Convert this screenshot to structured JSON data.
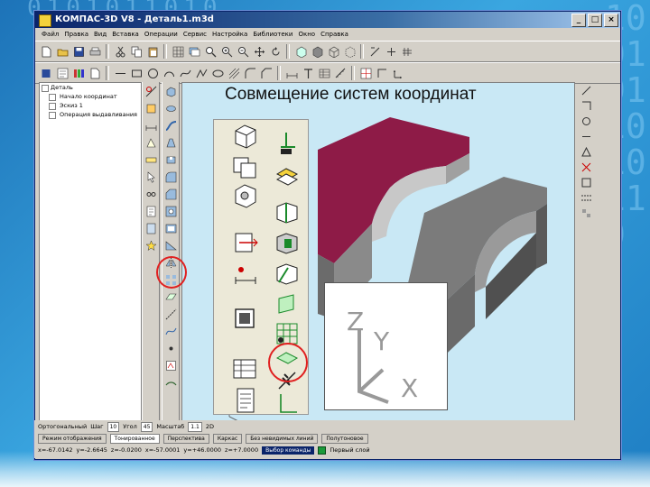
{
  "window": {
    "title": "КОМПАС-3D V8 - Деталь1.m3d"
  },
  "menu": [
    "Файл",
    "Правка",
    "Вид",
    "Вставка",
    "Операции",
    "Сервис",
    "Настройка",
    "Библиотеки",
    "Окно",
    "Справка"
  ],
  "tree": {
    "items": [
      {
        "label": "Деталь"
      },
      {
        "label": "Начало координат"
      },
      {
        "label": "Эскиз 1"
      },
      {
        "label": "Операция выдавливания"
      }
    ]
  },
  "slide": {
    "title": "Совмещение систем координат"
  },
  "axes": {
    "z": "Z",
    "y": "Y",
    "x": "X"
  },
  "status": {
    "row1": {
      "label1": "Ортогональный",
      "label2": "Шаг",
      "value1": "10",
      "label3": "Угол",
      "value2": "45",
      "label4": "Масштаб",
      "value3": "1.1",
      "value4": "2D"
    },
    "tabs": [
      "Режим отображения",
      "Тонированное",
      "Перспектива",
      "Каркас",
      "Без невидимых линий",
      "Полутоновое"
    ],
    "row3": {
      "x": "x=-67.0142",
      "y": "y=-2.6645",
      "z": "z=-0.0200",
      "coord1": "x=-57.0001",
      "coord2": "y=+46.0000",
      "coord3": "z=+7.0000",
      "command": "Выбор команды",
      "layer": "Первый слой"
    }
  },
  "colors": {
    "title_bar": "#0a246a",
    "part_maroon": "#8e1b47",
    "part_gray": "#7b7b7b",
    "highlight": "#e02020"
  }
}
